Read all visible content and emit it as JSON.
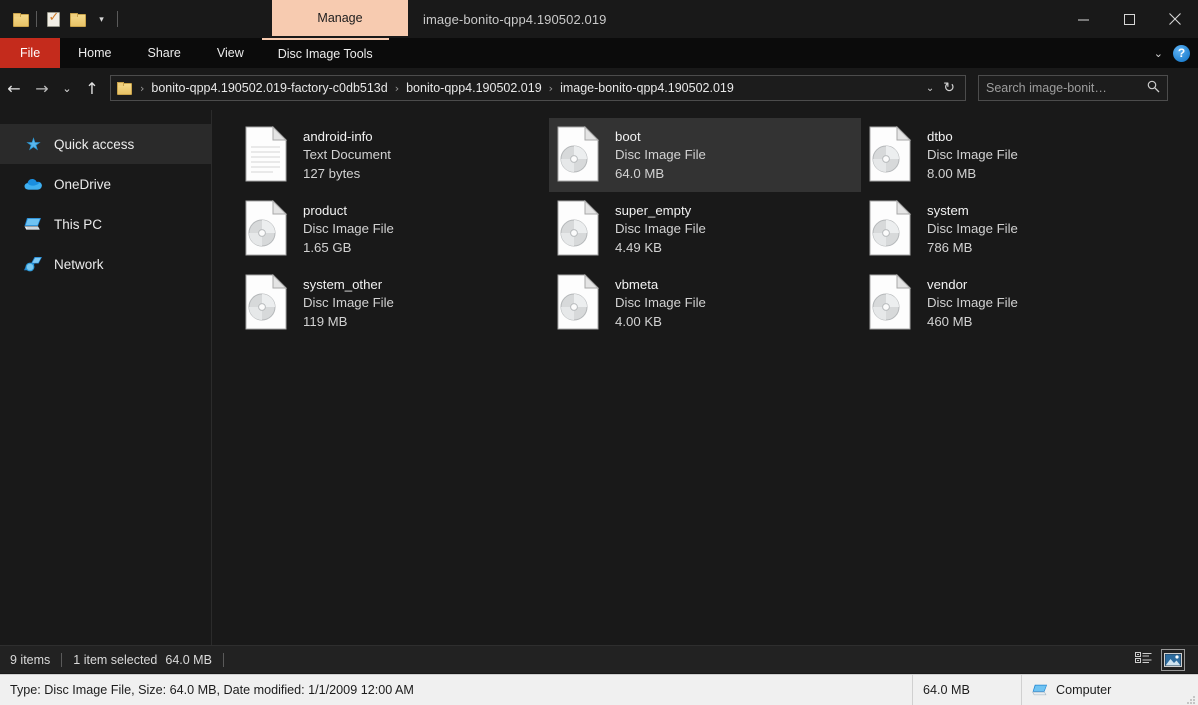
{
  "window": {
    "title": "image-bonito-qpp4.190502.019",
    "controls": {
      "minimize": "minimize-icon",
      "maximize": "maximize-icon",
      "close": "close-icon"
    },
    "quick_access_toolbar": [
      {
        "name": "properties-folder-icon",
        "label": ""
      },
      {
        "name": "properties-icon",
        "label": ""
      },
      {
        "name": "new-folder-icon",
        "label": ""
      },
      {
        "name": "customize-qat-caret",
        "label": "▾"
      }
    ]
  },
  "contextual": {
    "manage_label": "Manage"
  },
  "ribbon": {
    "tabs": [
      {
        "label": "File",
        "type": "file"
      },
      {
        "label": "Home",
        "type": "normal"
      },
      {
        "label": "Share",
        "type": "normal"
      },
      {
        "label": "View",
        "type": "normal"
      },
      {
        "label": "Disc Image Tools",
        "type": "contextual"
      }
    ],
    "expand_caret": "⌄",
    "help_glyph": "?"
  },
  "navigation": {
    "back": "←",
    "forward": "→",
    "recent": "⌄",
    "up": "↑",
    "breadcrumbs": [
      "bonito-qpp4.190502.019-factory-c0db513d",
      "bonito-qpp4.190502.019",
      "image-bonito-qpp4.190502.019"
    ],
    "separator": "›",
    "dropdown_caret": "⌄",
    "refresh_glyph": "↻"
  },
  "search": {
    "placeholder": "Search image-bonit…",
    "icon": "search-icon"
  },
  "sidebar": {
    "items": [
      {
        "label": "Quick access",
        "icon": "star-icon",
        "selected": true
      },
      {
        "label": "OneDrive",
        "icon": "cloud-icon",
        "selected": false
      },
      {
        "label": "This PC",
        "icon": "computer-icon",
        "selected": false
      },
      {
        "label": "Network",
        "icon": "network-icon",
        "selected": false
      }
    ]
  },
  "files": [
    {
      "name": "android-info",
      "type": "Text Document",
      "size": "127 bytes",
      "icon": "text-document-icon",
      "selected": false
    },
    {
      "name": "boot",
      "type": "Disc Image File",
      "size": "64.0 MB",
      "icon": "disc-image-icon",
      "selected": true
    },
    {
      "name": "dtbo",
      "type": "Disc Image File",
      "size": "8.00 MB",
      "icon": "disc-image-icon",
      "selected": false
    },
    {
      "name": "product",
      "type": "Disc Image File",
      "size": "1.65 GB",
      "icon": "disc-image-icon",
      "selected": false
    },
    {
      "name": "super_empty",
      "type": "Disc Image File",
      "size": "4.49 KB",
      "icon": "disc-image-icon",
      "selected": false
    },
    {
      "name": "system",
      "type": "Disc Image File",
      "size": "786 MB",
      "icon": "disc-image-icon",
      "selected": false
    },
    {
      "name": "system_other",
      "type": "Disc Image File",
      "size": "119 MB",
      "icon": "disc-image-icon",
      "selected": false
    },
    {
      "name": "vbmeta",
      "type": "Disc Image File",
      "size": "4.00 KB",
      "icon": "disc-image-icon",
      "selected": false
    },
    {
      "name": "vendor",
      "type": "Disc Image File",
      "size": "460 MB",
      "icon": "disc-image-icon",
      "selected": false
    }
  ],
  "status": {
    "item_count": "9 items",
    "selection": "1 item selected",
    "selection_size": "64.0 MB",
    "details_view_icon": "details-view-icon",
    "large_icons_view_icon": "large-icons-view-icon"
  },
  "details_pane": {
    "info": "Type: Disc Image File, Size: 64.0 MB, Date modified: 1/1/2009 12:00 AM",
    "size": "64.0 MB",
    "location": "Computer",
    "location_icon": "computer-icon"
  },
  "colors": {
    "window_bg": "#191919",
    "ribbon_bg": "#0b0b0b",
    "file_tab": "#c42b1c",
    "contextual_accent": "#f7cbb0",
    "selection": "#333333",
    "sidebar_selection": "#2a2a2a",
    "details_pane_bg": "#f0f0f0"
  }
}
